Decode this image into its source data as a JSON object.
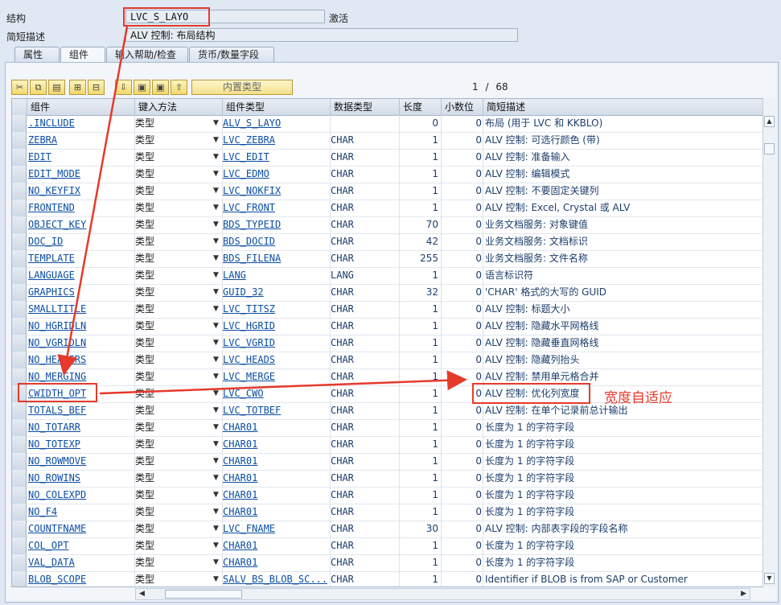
{
  "header": {
    "structure_label": "结构",
    "structure_value": "LVC_S_LAYO",
    "status": "激活",
    "desc_label": "简短描述",
    "desc_value": "ALV 控制: 布局结构"
  },
  "tabs": [
    "属性",
    "组件",
    "输入帮助/检查",
    "货币/数量字段"
  ],
  "toolbar": {
    "builtin_type_label": "内置类型",
    "page_current": "1",
    "page_sep": "/",
    "page_total": "68"
  },
  "columns": [
    "组件",
    "键入方法",
    "组件类型",
    "数据类型",
    "长度",
    "小数位",
    "简短描述"
  ],
  "rows": [
    {
      "comp": ".INCLUDE",
      "input": "类型",
      "type": "ALV_S_LAYO",
      "dt": "",
      "len": "0",
      "dec": "0",
      "desc": "布局 (用于 LVC 和 KKBLO)"
    },
    {
      "comp": "ZEBRA",
      "input": "类型",
      "type": "LVC_ZEBRA",
      "dt": "CHAR",
      "len": "1",
      "dec": "0",
      "desc": "ALV 控制: 可选行颜色 (带)"
    },
    {
      "comp": "EDIT",
      "input": "类型",
      "type": "LVC_EDIT",
      "dt": "CHAR",
      "len": "1",
      "dec": "0",
      "desc": "ALV 控制: 准备输入"
    },
    {
      "comp": "EDIT_MODE",
      "input": "类型",
      "type": "LVC_EDMO",
      "dt": "CHAR",
      "len": "1",
      "dec": "0",
      "desc": "ALV 控制: 编辑模式"
    },
    {
      "comp": "NO_KEYFIX",
      "input": "类型",
      "type": "LVC_NOKFIX",
      "dt": "CHAR",
      "len": "1",
      "dec": "0",
      "desc": "ALV 控制: 不要固定关键列"
    },
    {
      "comp": "FRONTEND",
      "input": "类型",
      "type": "LVC_FRONT",
      "dt": "CHAR",
      "len": "1",
      "dec": "0",
      "desc": "ALV 控制: Excel, Crystal 或 ALV"
    },
    {
      "comp": "OBJECT_KEY",
      "input": "类型",
      "type": "BDS_TYPEID",
      "dt": "CHAR",
      "len": "70",
      "dec": "0",
      "desc": "业务文档服务: 对象键值"
    },
    {
      "comp": "DOC_ID",
      "input": "类型",
      "type": "BDS_DOCID",
      "dt": "CHAR",
      "len": "42",
      "dec": "0",
      "desc": "业务文档服务: 文档标识"
    },
    {
      "comp": "TEMPLATE",
      "input": "类型",
      "type": "BDS_FILENA",
      "dt": "CHAR",
      "len": "255",
      "dec": "0",
      "desc": "业务文档服务: 文件名称"
    },
    {
      "comp": "LANGUAGE",
      "input": "类型",
      "type": "LANG",
      "dt": "LANG",
      "len": "1",
      "dec": "0",
      "desc": "语言标识符"
    },
    {
      "comp": "GRAPHICS",
      "input": "类型",
      "type": "GUID_32",
      "dt": "CHAR",
      "len": "32",
      "dec": "0",
      "desc": "'CHAR' 格式的大写的 GUID"
    },
    {
      "comp": "SMALLTITLE",
      "input": "类型",
      "type": "LVC_TITSZ",
      "dt": "CHAR",
      "len": "1",
      "dec": "0",
      "desc": "ALV 控制: 标题大小"
    },
    {
      "comp": "NO_HGRIDLN",
      "input": "类型",
      "type": "LVC_HGRID",
      "dt": "CHAR",
      "len": "1",
      "dec": "0",
      "desc": "ALV 控制: 隐藏水平网格线"
    },
    {
      "comp": "NO_VGRIDLN",
      "input": "类型",
      "type": "LVC_VGRID",
      "dt": "CHAR",
      "len": "1",
      "dec": "0",
      "desc": "ALV 控制: 隐藏垂直网格线"
    },
    {
      "comp": "NO_HEADERS",
      "input": "类型",
      "type": "LVC_HEADS",
      "dt": "CHAR",
      "len": "1",
      "dec": "0",
      "desc": "ALV 控制: 隐藏列抬头"
    },
    {
      "comp": "NO_MERGING",
      "input": "类型",
      "type": "LVC_MERGE",
      "dt": "CHAR",
      "len": "1",
      "dec": "0",
      "desc": "ALV 控制: 禁用单元格合并"
    },
    {
      "comp": "CWIDTH_OPT",
      "input": "类型",
      "type": "LVC_CWO",
      "dt": "CHAR",
      "len": "1",
      "dec": "0",
      "desc": "ALV 控制: 优化列宽度"
    },
    {
      "comp": "TOTALS_BEF",
      "input": "类型",
      "type": "LVC_TOTBEF",
      "dt": "CHAR",
      "len": "1",
      "dec": "0",
      "desc": "ALV 控制: 在单个记录前总计输出"
    },
    {
      "comp": "NO_TOTARR",
      "input": "类型",
      "type": "CHAR01",
      "dt": "CHAR",
      "len": "1",
      "dec": "0",
      "desc": "长度为 1 的字符字段"
    },
    {
      "comp": "NO_TOTEXP",
      "input": "类型",
      "type": "CHAR01",
      "dt": "CHAR",
      "len": "1",
      "dec": "0",
      "desc": "长度为 1 的字符字段"
    },
    {
      "comp": "NO_ROWMOVE",
      "input": "类型",
      "type": "CHAR01",
      "dt": "CHAR",
      "len": "1",
      "dec": "0",
      "desc": "长度为 1 的字符字段"
    },
    {
      "comp": "NO_ROWINS",
      "input": "类型",
      "type": "CHAR01",
      "dt": "CHAR",
      "len": "1",
      "dec": "0",
      "desc": "长度为 1 的字符字段"
    },
    {
      "comp": "NO_COLEXPD",
      "input": "类型",
      "type": "CHAR01",
      "dt": "CHAR",
      "len": "1",
      "dec": "0",
      "desc": "长度为 1 的字符字段"
    },
    {
      "comp": "NO_F4",
      "input": "类型",
      "type": "CHAR01",
      "dt": "CHAR",
      "len": "1",
      "dec": "0",
      "desc": "长度为 1 的字符字段"
    },
    {
      "comp": "COUNTFNAME",
      "input": "类型",
      "type": "LVC_FNAME",
      "dt": "CHAR",
      "len": "30",
      "dec": "0",
      "desc": "ALV 控制: 内部表字段的字段名称"
    },
    {
      "comp": "COL_OPT",
      "input": "类型",
      "type": "CHAR01",
      "dt": "CHAR",
      "len": "1",
      "dec": "0",
      "desc": "长度为 1 的字符字段"
    },
    {
      "comp": "VAL_DATA",
      "input": "类型",
      "type": "CHAR01",
      "dt": "CHAR",
      "len": "1",
      "dec": "0",
      "desc": "长度为 1 的字符字段"
    },
    {
      "comp": "BLOB_SCOPE",
      "input": "类型",
      "type": "SALV_BS_BLOB_SC...",
      "dt": "CHAR",
      "len": "1",
      "dec": "0",
      "desc": "Identifier if BLOB is from SAP or Customer"
    }
  ],
  "annotation": {
    "text": "宽度自适应",
    "color": "#e53a2b"
  }
}
